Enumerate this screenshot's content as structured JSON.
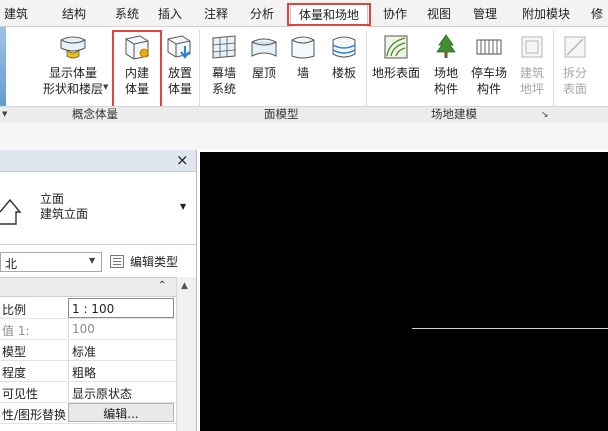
{
  "ribbon_tabs": [
    "建筑",
    "结构",
    "系统",
    "插入",
    "注释",
    "分析",
    "体量和场地",
    "协作",
    "视图",
    "管理",
    "附加模块",
    "修"
  ],
  "active_tab": "体量和场地",
  "ribbon": {
    "conceptual_mass": {
      "title": "概念体量",
      "show_mass": [
        "显示体量",
        "形状和楼层"
      ],
      "in_place_mass": [
        "内建",
        "体量"
      ],
      "place_mass": [
        "放置",
        "体量"
      ]
    },
    "model_by_face": {
      "title": "面模型",
      "curtain_system": [
        "幕墙",
        "系统"
      ],
      "roof": "屋顶",
      "wall": "墙",
      "floor": "楼板"
    },
    "site_model": {
      "title": "场地建模",
      "toposurface": "地形表面",
      "site_component": [
        "场地",
        "构件"
      ],
      "parking_component": [
        "停车场",
        "构件"
      ],
      "building_pad": [
        "建筑",
        "地坪"
      ],
      "split_surface": [
        "拆分",
        "表面"
      ]
    }
  },
  "properties": {
    "close": "×",
    "type_name": [
      "立面",
      "建筑立面"
    ],
    "filter_value": "北",
    "edit_type": "编辑类型",
    "rows": [
      {
        "label": "比例",
        "value": "1 : 100"
      },
      {
        "label": "值 1:",
        "value": "100"
      },
      {
        "label": "模型",
        "value": "标准"
      },
      {
        "label": "程度",
        "value": "粗略"
      },
      {
        "label": "可见性",
        "value": "显示原状态"
      },
      {
        "label": "性/图形替换",
        "value": "编辑..."
      }
    ]
  },
  "colors": {
    "highlight": "#e0443c",
    "viewport_bg": "#000000"
  }
}
